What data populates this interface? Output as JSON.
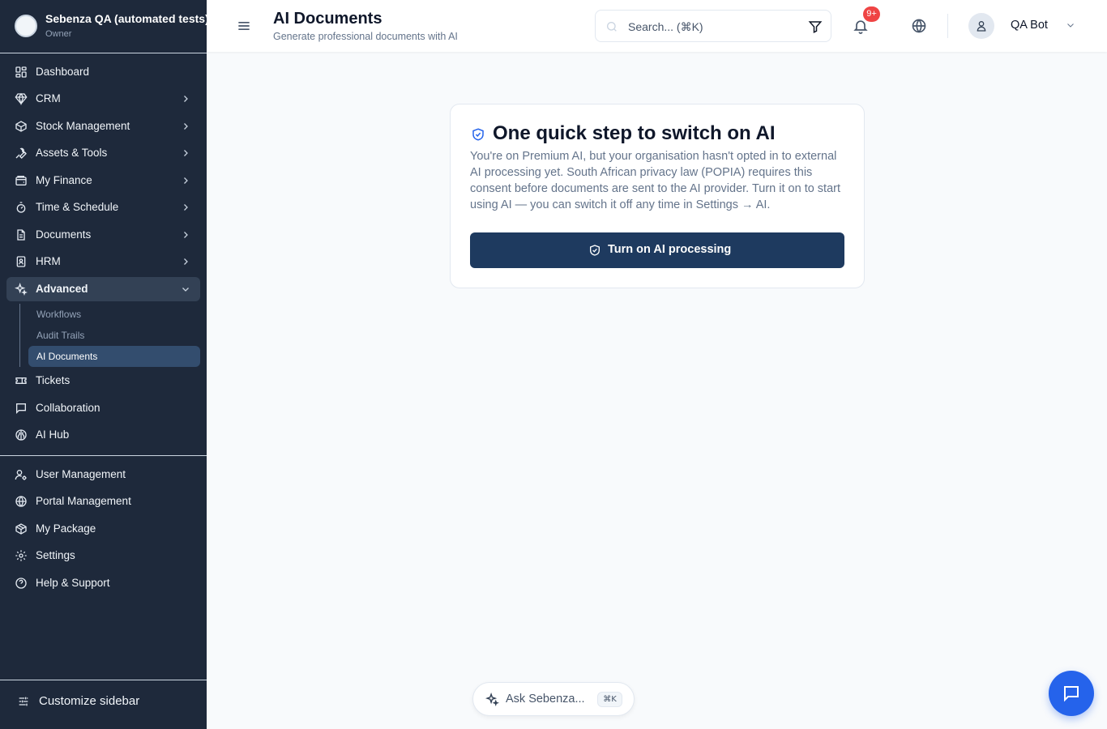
{
  "org": {
    "name": "Sebenza QA (automated tests)",
    "role": "Owner"
  },
  "sidebar": {
    "items": [
      {
        "label": "Dashboard",
        "icon": "dashboard-icon",
        "expandable": false
      },
      {
        "label": "CRM",
        "icon": "gem-icon",
        "expandable": true
      },
      {
        "label": "Stock Management",
        "icon": "box-icon",
        "expandable": true
      },
      {
        "label": "Assets & Tools",
        "icon": "wrench-icon",
        "expandable": true
      },
      {
        "label": "My Finance",
        "icon": "wallet-icon",
        "expandable": true
      },
      {
        "label": "Time & Schedule",
        "icon": "timer-icon",
        "expandable": true
      },
      {
        "label": "Documents",
        "icon": "file-icon",
        "expandable": true
      },
      {
        "label": "HRM",
        "icon": "id-badge-icon",
        "expandable": true
      },
      {
        "label": "Advanced",
        "icon": "sparkles-icon",
        "expandable": true,
        "expanded": true
      },
      {
        "label": "Tickets",
        "icon": "ticket-icon",
        "expandable": false
      },
      {
        "label": "Collaboration",
        "icon": "chat-bubble-icon",
        "expandable": false
      },
      {
        "label": "AI Hub",
        "icon": "brain-icon",
        "expandable": false
      }
    ],
    "advanced_sub": [
      {
        "label": "Workflows"
      },
      {
        "label": "Audit Trails"
      },
      {
        "label": "AI Documents",
        "active": true
      }
    ],
    "bottom_items": [
      {
        "label": "User Management",
        "icon": "user-cog-icon"
      },
      {
        "label": "Portal Management",
        "icon": "globe-icon"
      },
      {
        "label": "My Package",
        "icon": "package-icon"
      },
      {
        "label": "Settings",
        "icon": "gear-icon"
      },
      {
        "label": "Help & Support",
        "icon": "help-circle-icon"
      }
    ],
    "customize_label": "Customize sidebar"
  },
  "header": {
    "title": "AI Documents",
    "subtitle": "Generate professional documents with AI",
    "search_placeholder": "Search... (⌘K)",
    "notification_badge": "9+",
    "user_name": "QA Bot"
  },
  "card": {
    "title": "One quick step to switch on AI",
    "body": "You're on Premium AI, but your organisation hasn't opted in to external AI processing yet. South African privacy law (POPIA) requires this consent before documents are sent to the AI provider. Turn it on to start using AI — you can switch it off any time in Settings → AI.",
    "button_label": "Turn on AI processing"
  },
  "ask": {
    "label": "Ask Sebenza...",
    "shortcut": "⌘K"
  },
  "colors": {
    "sidebar_bg": "#1e293b",
    "accent": "#2563eb",
    "primary_button": "#1e3a5f",
    "badge": "#ef4444"
  }
}
